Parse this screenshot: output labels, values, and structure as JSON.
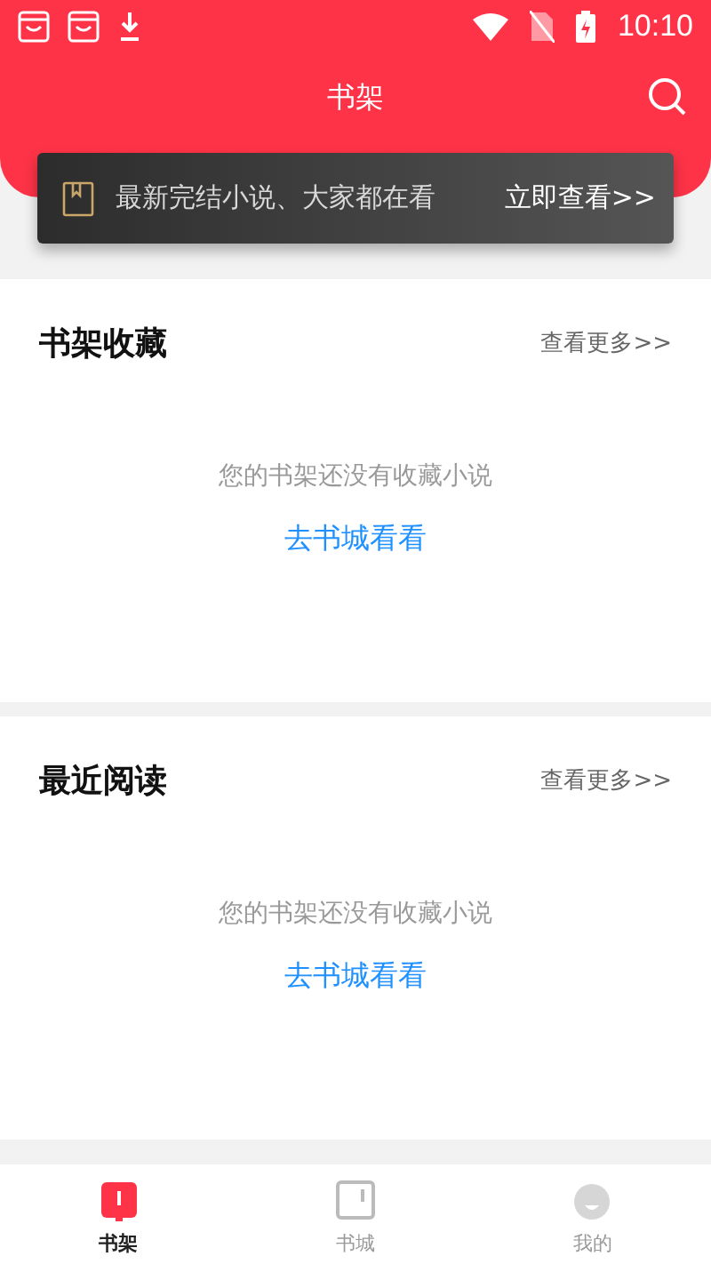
{
  "status_bar": {
    "time": "10:10"
  },
  "header": {
    "title": "书架"
  },
  "banner": {
    "text": "最新完结小说、大家都在看",
    "action": "立即查看>>"
  },
  "sections": [
    {
      "title": "书架收藏",
      "more": "查看更多>>",
      "empty_text": "您的书架还没有收藏小说",
      "link": "去书城看看"
    },
    {
      "title": "最近阅读",
      "more": "查看更多>>",
      "empty_text": "您的书架还没有收藏小说",
      "link": "去书城看看"
    }
  ],
  "tabs": [
    {
      "label": "书架",
      "kind": "shelf",
      "selected": true
    },
    {
      "label": "书城",
      "kind": "store",
      "selected": false
    },
    {
      "label": "我的",
      "kind": "profile",
      "selected": false
    }
  ]
}
